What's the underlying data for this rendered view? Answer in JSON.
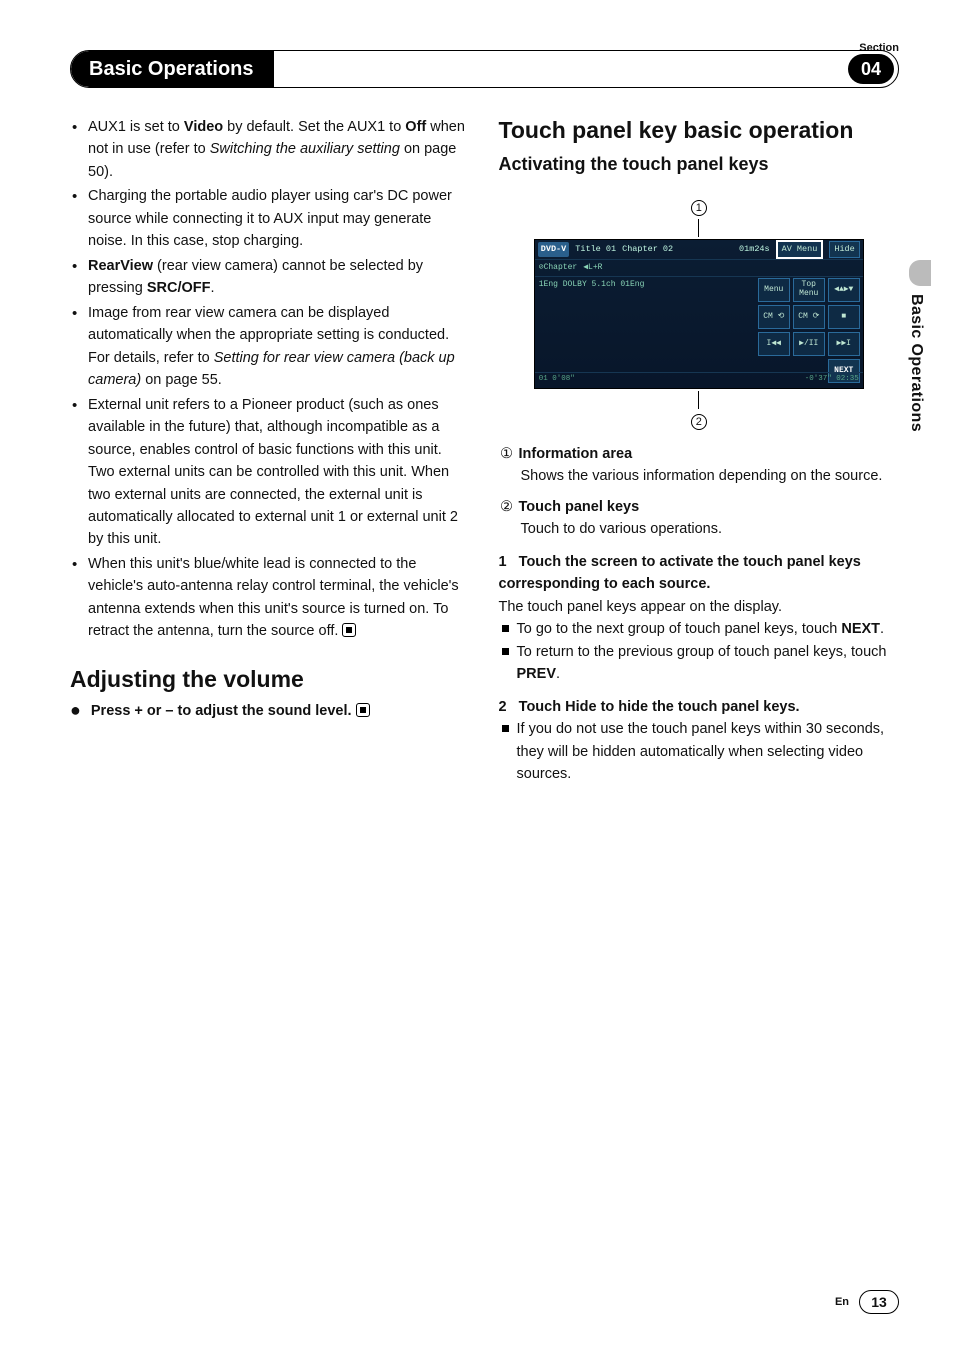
{
  "header": {
    "section_label": "Section",
    "title": "Basic Operations",
    "section_number": "04"
  },
  "side_tab": "Basic Operations",
  "footer": {
    "lang": "En",
    "page": "13"
  },
  "left": {
    "bullets": {
      "b1_a": "AUX1 is set to ",
      "b1_b": "Video",
      "b1_c": " by default. Set the AUX1 to ",
      "b1_d": "Off",
      "b1_e": " when not in use (refer to ",
      "b1_f": "Switching the auxiliary setting",
      "b1_g": " on page 50).",
      "b2": "Charging the portable audio player using car's DC power source while connecting it to AUX input may generate noise. In this case, stop charging.",
      "b3_a": "RearView",
      "b3_b": " (rear view camera) cannot be selected by pressing ",
      "b3_c": "SRC/OFF",
      "b3_d": ".",
      "b4_a": "Image from rear view camera can be displayed automatically when the appropriate setting is conducted. For details, refer to ",
      "b4_b": "Setting for rear view camera (back up camera)",
      "b4_c": " on page 55.",
      "b5": "External unit refers to a Pioneer product (such as ones available in the future) that, although incompatible as a source, enables control of basic functions with this unit. Two external units can be controlled with this unit. When two external units are connected, the external unit is automatically allocated to external unit 1 or external unit 2 by this unit.",
      "b6": "When this unit's blue/white lead is connected to the vehicle's auto-antenna relay control terminal, the vehicle's antenna extends when this unit's source is turned on. To retract the antenna, turn the source off. "
    },
    "adjusting_heading": "Adjusting the volume",
    "adjusting_step": "Press + or – to adjust the sound level. "
  },
  "right": {
    "h2": "Touch panel key basic operation",
    "h3": "Activating the touch panel keys",
    "fig": {
      "c1": "1",
      "c2": "2",
      "source_badge": "DVD-V",
      "title_label": "Title",
      "title_num": "01",
      "chapter_label": "Chapter",
      "chapter_num": "02",
      "time": "01m24s",
      "av_menu": "AV Menu",
      "hide": "Hide",
      "sub_chapter": "Chapter",
      "sub_lr": "L+R",
      "sub_line": "1Eng   DOLBY 5.1ch   01Eng",
      "keys": {
        "menu": "Menu",
        "top_menu": "Top Menu",
        "arrows": "◀▲▶▼",
        "cm_back": "CM ⟲",
        "cm_fwd": "CM ⟳",
        "stop": "■",
        "prev": "I◀◀",
        "playpause": "▶/II",
        "next_trk": "▶▶I",
        "next": "NEXT"
      },
      "bottom_left": "01 0'08\"",
      "bottom_right": "-0'37\" 02:35"
    },
    "def": {
      "n1": "①",
      "t1": "Information area",
      "d1": "Shows the various information depending on the source.",
      "n2": "②",
      "t2": "Touch panel keys",
      "d2": "Touch to do various operations."
    },
    "steps": {
      "s1_num": "1",
      "s1_head": "Touch the screen to activate the touch panel keys corresponding to each source.",
      "s1_body": "The touch panel keys appear on the display.",
      "s1_sub1_a": "To go to the next group of touch panel keys, touch ",
      "s1_sub1_b": "NEXT",
      "s1_sub1_c": ".",
      "s1_sub2_a": "To return to the previous group of touch panel keys, touch ",
      "s1_sub2_b": "PREV",
      "s1_sub2_c": ".",
      "s2_num": "2",
      "s2_head": "Touch Hide to hide the touch panel keys.",
      "s2_sub1": "If you do not use the touch panel keys within 30 seconds, they will be hidden automatically when selecting video sources."
    }
  }
}
